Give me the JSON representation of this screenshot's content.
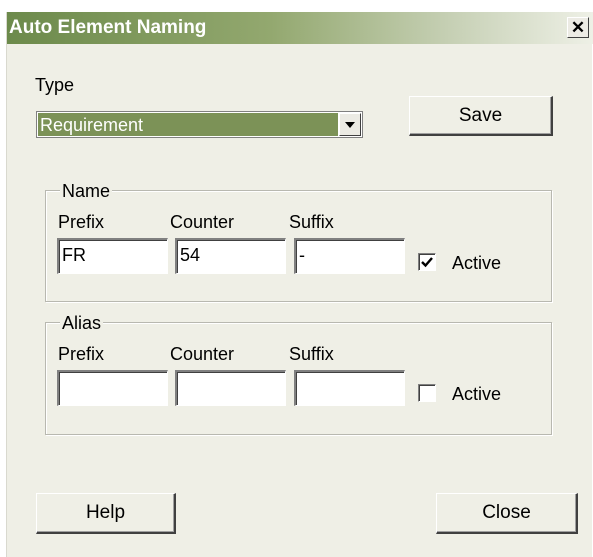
{
  "window": {
    "title": "Auto Element Naming",
    "close_glyph": "✕",
    "close_icon": "close-icon"
  },
  "type": {
    "label": "Type",
    "selected": "Requirement",
    "dropdown_icon": "chevron-down-icon"
  },
  "buttons": {
    "save": "Save",
    "help": "Help",
    "close": "Close"
  },
  "name_group": {
    "legend": "Name",
    "prefix_label": "Prefix",
    "counter_label": "Counter",
    "suffix_label": "Suffix",
    "prefix_value": "FR",
    "counter_value": "54",
    "suffix_value": "-",
    "active_label": "Active",
    "active_checked": true
  },
  "alias_group": {
    "legend": "Alias",
    "prefix_label": "Prefix",
    "counter_label": "Counter",
    "suffix_label": "Suffix",
    "prefix_value": "",
    "counter_value": "",
    "suffix_value": "",
    "active_label": "Active",
    "active_checked": false
  },
  "colors": {
    "title_gradient_start": "#6c8a4b",
    "selection_bg": "#7c9257",
    "dialog_bg": "#efefe6"
  }
}
